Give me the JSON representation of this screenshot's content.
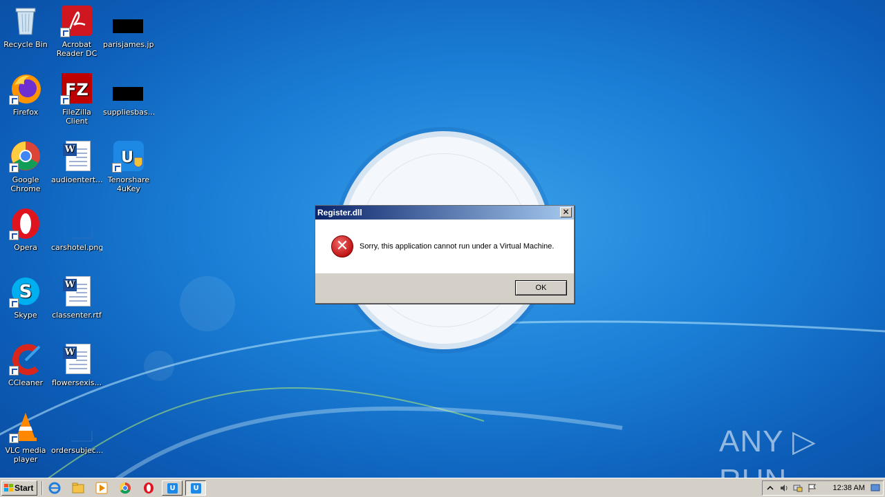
{
  "desktop": {
    "icons": [
      {
        "label": "Recycle Bin"
      },
      {
        "label": "Acrobat Reader DC"
      },
      {
        "label": "parisjames.jpg"
      },
      {
        "label": "Firefox"
      },
      {
        "label": "FileZilla Client"
      },
      {
        "label": "suppliesbas..."
      },
      {
        "label": "Google Chrome"
      },
      {
        "label": "audioentert..."
      },
      {
        "label": "Tenorshare 4uKey"
      },
      {
        "label": "Opera"
      },
      {
        "label": "carshotel.png"
      },
      {
        "label": "Skype"
      },
      {
        "label": "classenter.rtf"
      },
      {
        "label": "CCleaner"
      },
      {
        "label": "flowersexis..."
      },
      {
        "label": "VLC media player"
      },
      {
        "label": "ordersubjec..."
      }
    ]
  },
  "dialog": {
    "title": "Register.dll",
    "close_glyph": "✕",
    "icon": "error-icon",
    "error_glyph": "✕",
    "message": "Sorry, this application cannot run under a Virtual Machine.",
    "ok_label": "OK"
  },
  "watermark": {
    "text": "ANY ▷ RUN"
  },
  "taskbar": {
    "start_label": "Start",
    "clock": "12:38 AM",
    "quick_launch": [
      "ie-icon",
      "explorer-icon",
      "media-player-icon",
      "chrome-icon",
      "opera-icon"
    ],
    "tasks": [
      {
        "glyph": "U"
      },
      {
        "glyph": "U"
      }
    ]
  },
  "colors": {
    "titlebar_start": "#0a246a",
    "titlebar_end": "#a6caf0",
    "error_red": "#c11515",
    "taskbar": "#d4d0c8"
  }
}
